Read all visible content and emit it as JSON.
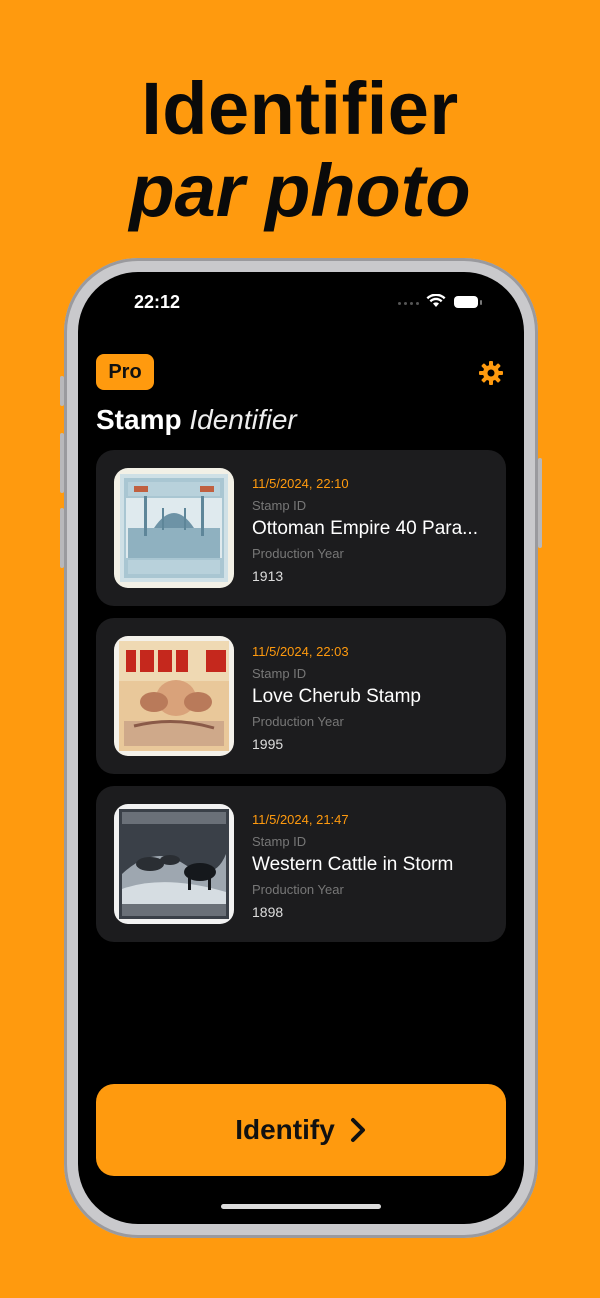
{
  "promo": {
    "line1": "Identifier",
    "line2": "par photo"
  },
  "status_bar": {
    "time": "22:12"
  },
  "header": {
    "pro_label": "Pro",
    "title_bold": "Stamp",
    "title_italic": "Identifier"
  },
  "labels": {
    "stamp_id": "Stamp ID",
    "production_year": "Production Year"
  },
  "stamps": [
    {
      "date": "11/5/2024, 22:10",
      "name": "Ottoman Empire 40 Para...",
      "year": "1913"
    },
    {
      "date": "11/5/2024, 22:03",
      "name": "Love Cherub Stamp",
      "year": "1995"
    },
    {
      "date": "11/5/2024, 21:47",
      "name": "Western Cattle in Storm",
      "year": "1898"
    }
  ],
  "identify_button": {
    "label": "Identify"
  },
  "colors": {
    "accent": "#FF9A0E",
    "card": "#1c1c1e",
    "screen": "#000000"
  },
  "icons": [
    "gear-icon",
    "chevron-right-icon",
    "wifi-icon",
    "battery-icon"
  ]
}
